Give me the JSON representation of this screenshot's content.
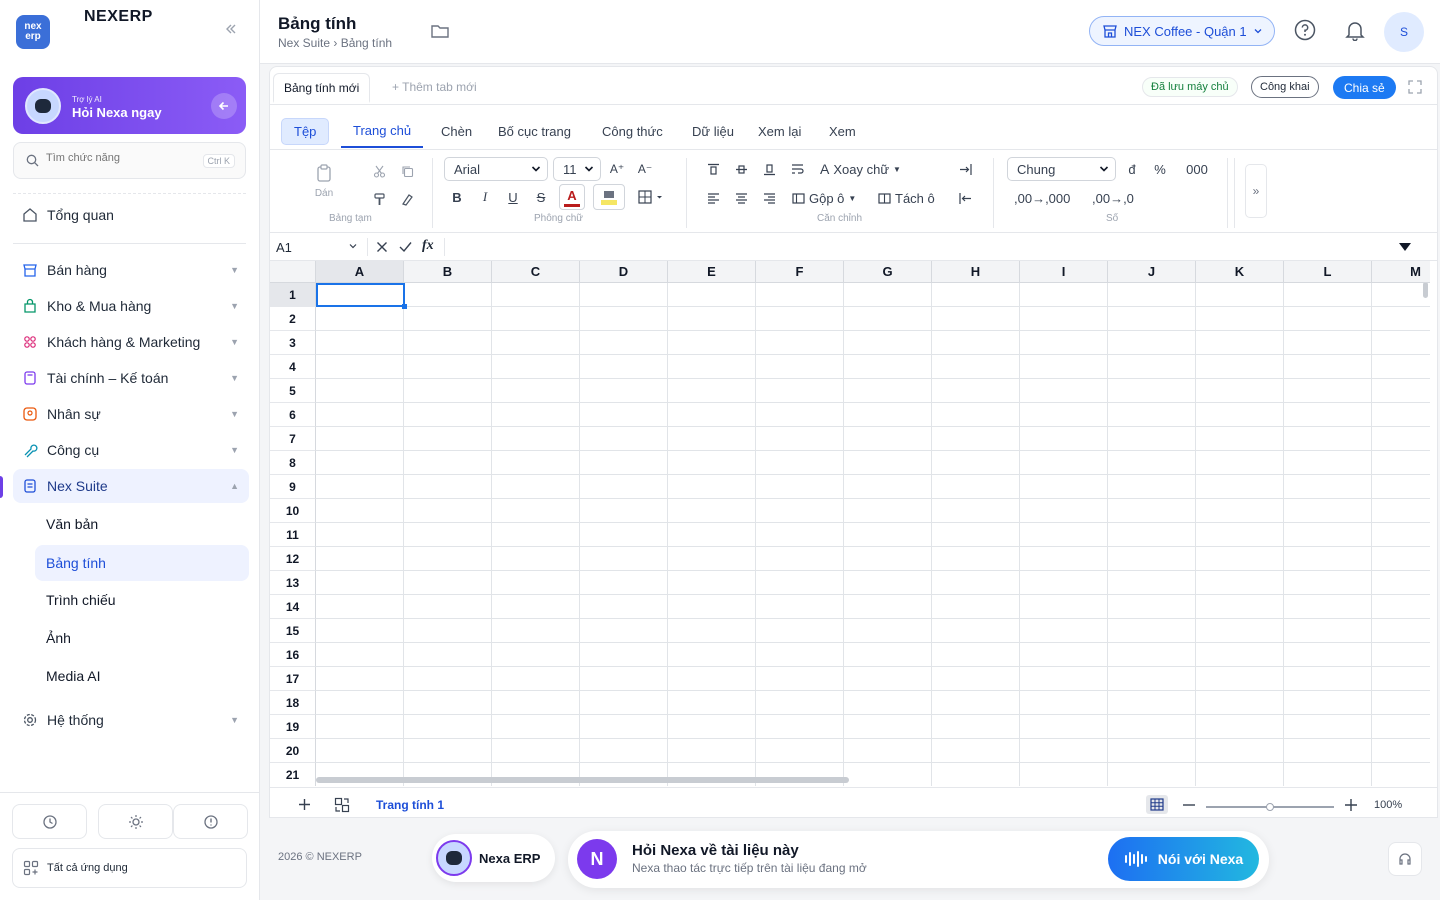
{
  "sidebar": {
    "logo_text": "nex erp",
    "brand": "NEXERP",
    "ai": {
      "small": "Trợ lý AI",
      "big": "Hỏi Nexa ngay"
    },
    "search": {
      "placeholder": "Tìm chức năng",
      "shortcut": "Ctrl K"
    },
    "overview": "Tổng quan",
    "items": [
      {
        "label": "Bán hàng",
        "icon": "shop-icon"
      },
      {
        "label": "Kho & Mua hàng",
        "icon": "bag-icon"
      },
      {
        "label": "Khách hàng & Marketing",
        "icon": "people-icon"
      },
      {
        "label": "Tài chính – Kế toán",
        "icon": "calculator-icon"
      },
      {
        "label": "Nhân sự",
        "icon": "user-icon"
      },
      {
        "label": "Công cụ",
        "icon": "wrench-icon"
      },
      {
        "label": "Nex Suite",
        "icon": "document-icon"
      }
    ],
    "sub_items": [
      "Văn bản",
      "Bảng tính",
      "Trình chiếu",
      "Ảnh",
      "Media AI"
    ],
    "system": "Hệ thống",
    "all_apps": "Tất cả ứng dụng"
  },
  "header": {
    "title": "Bảng tính",
    "breadcrumb": "Nex Suite › Bảng tính",
    "store": "NEX Coffee - Quận 1",
    "avatar": "S"
  },
  "doc": {
    "tab": "Bảng tính mới",
    "add_tab": "+ Thêm tab mới",
    "saved": "Đã lưu máy chủ",
    "public": "Công khai",
    "share": "Chia sẻ"
  },
  "menu": [
    "Tệp",
    "Trang chủ",
    "Chèn",
    "Bố cục trang",
    "Công thức",
    "Dữ liệu",
    "Xem lại",
    "Xem"
  ],
  "ribbon": {
    "paste": "Dán",
    "groups": [
      "Bảng tạm",
      "Phông chữ",
      "Căn chỉnh",
      "Số"
    ],
    "font": "Arial",
    "size": "11",
    "bold": "B",
    "italic": "I",
    "underline": "U",
    "strike": "S",
    "font_color": "A",
    "rotate": "Xoay chữ",
    "merge": "Gộp ô",
    "split": "Tách ô",
    "number_format": "Chung",
    "currency": "đ",
    "percent": "%",
    "thousands": "000",
    "inc_decimal": ",00→,000",
    "dec_decimal": ",00→,0",
    "more": "»"
  },
  "formula": {
    "cell_ref": "A1",
    "fx": "fx"
  },
  "grid": {
    "columns": [
      "A",
      "B",
      "C",
      "D",
      "E",
      "F",
      "G",
      "H",
      "I",
      "J",
      "K",
      "L",
      "M"
    ],
    "rows": [
      "1",
      "2",
      "3",
      "4",
      "5",
      "6",
      "7",
      "8",
      "9",
      "10",
      "11",
      "12",
      "13",
      "14",
      "15",
      "16",
      "17",
      "18",
      "19",
      "20",
      "21"
    ],
    "active_cell": "A1"
  },
  "sheetbar": {
    "sheet": "Trang tính 1",
    "zoom": "100%",
    "zoom_fraction": 0.5
  },
  "footer": {
    "copyright": "2026 © NEXERP",
    "nexa_erp": "Nexa ERP",
    "ask_avatar": "N",
    "ask_title": "Hỏi Nexa về tài liệu này",
    "ask_sub": "Nexa thao tác trực tiếp trên tài liệu đang mở",
    "talk": "Nói với Nexa"
  },
  "colors": {
    "accent": "#1d4ed8",
    "ai_purple": "#6d3fe6",
    "share": "#1d7af3"
  }
}
